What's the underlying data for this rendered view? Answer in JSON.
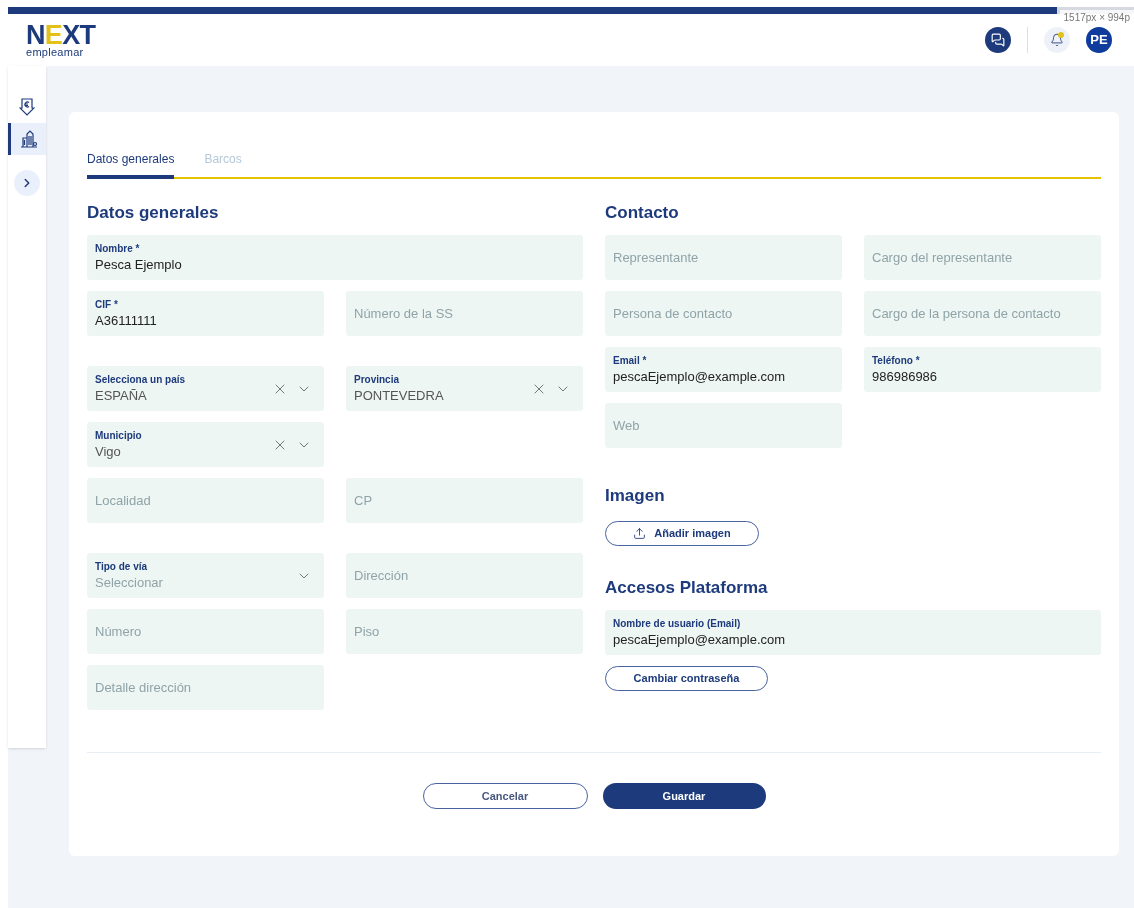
{
  "overlay": {
    "text": "1517px × 994p"
  },
  "header": {
    "logo": {
      "wordmark": "NEXT",
      "subtitle": "empleamar"
    },
    "notifications": {
      "unread": true
    },
    "avatar": "PE"
  },
  "sidebar": {
    "items": [
      {
        "selected": false
      },
      {
        "selected": true
      }
    ]
  },
  "tabs": [
    {
      "label": "Datos generales",
      "selected": true
    },
    {
      "label": "Barcos",
      "selected": false
    }
  ],
  "left": {
    "title": "Datos generales",
    "groups": [
      [
        [
          {
            "kind": "text",
            "label": "Nombre *",
            "value": "Pesca Ejemplo"
          }
        ],
        [
          {
            "kind": "text",
            "label": "CIF *",
            "value": "A36111111"
          },
          {
            "kind": "text",
            "placeholder": "Número de la SS"
          }
        ]
      ],
      [
        [
          {
            "kind": "select",
            "label": "Selecciona un país",
            "value": "ESPAÑA",
            "clearable": true
          },
          {
            "kind": "select",
            "label": "Provincia",
            "value": "PONTEVEDRA",
            "clearable": true
          }
        ],
        [
          {
            "kind": "select",
            "label": "Municipio",
            "value": "Vigo",
            "clearable": true
          }
        ],
        [
          {
            "kind": "text",
            "placeholder": "Localidad"
          },
          {
            "kind": "text",
            "placeholder": "CP"
          }
        ]
      ],
      [
        [
          {
            "kind": "select",
            "label": "Tipo de vía",
            "placeholder": "Seleccionar",
            "clearable": false
          },
          {
            "kind": "text",
            "placeholder": "Dirección"
          }
        ],
        [
          {
            "kind": "text",
            "placeholder": "Número"
          },
          {
            "kind": "text",
            "placeholder": "Piso"
          }
        ],
        [
          {
            "kind": "text",
            "placeholder": "Detalle dirección"
          }
        ]
      ]
    ]
  },
  "contact": {
    "title": "Contacto",
    "rows": [
      [
        {
          "kind": "text",
          "placeholder": "Representante"
        },
        {
          "kind": "text",
          "placeholder": "Cargo del representante"
        }
      ],
      [
        {
          "kind": "text",
          "placeholder": "Persona de contacto"
        },
        {
          "kind": "text",
          "placeholder": "Cargo de la persona de contacto"
        }
      ],
      [
        {
          "kind": "text",
          "label": "Email *",
          "value": "pescaEjemplo@example.com"
        },
        {
          "kind": "text",
          "label": "Teléfono *",
          "value": "986986986"
        }
      ],
      [
        {
          "kind": "text",
          "placeholder": "Web"
        }
      ]
    ]
  },
  "image": {
    "title": "Imagen",
    "button": "Añadir imagen"
  },
  "access": {
    "title": "Accesos Plataforma",
    "field": {
      "kind": "text",
      "label": "Nombre de usuario (Email)",
      "value": "pescaEjemplo@example.com"
    },
    "button": "Cambiar contraseña"
  },
  "footer": {
    "cancel": "Cancelar",
    "save": "Guardar"
  }
}
